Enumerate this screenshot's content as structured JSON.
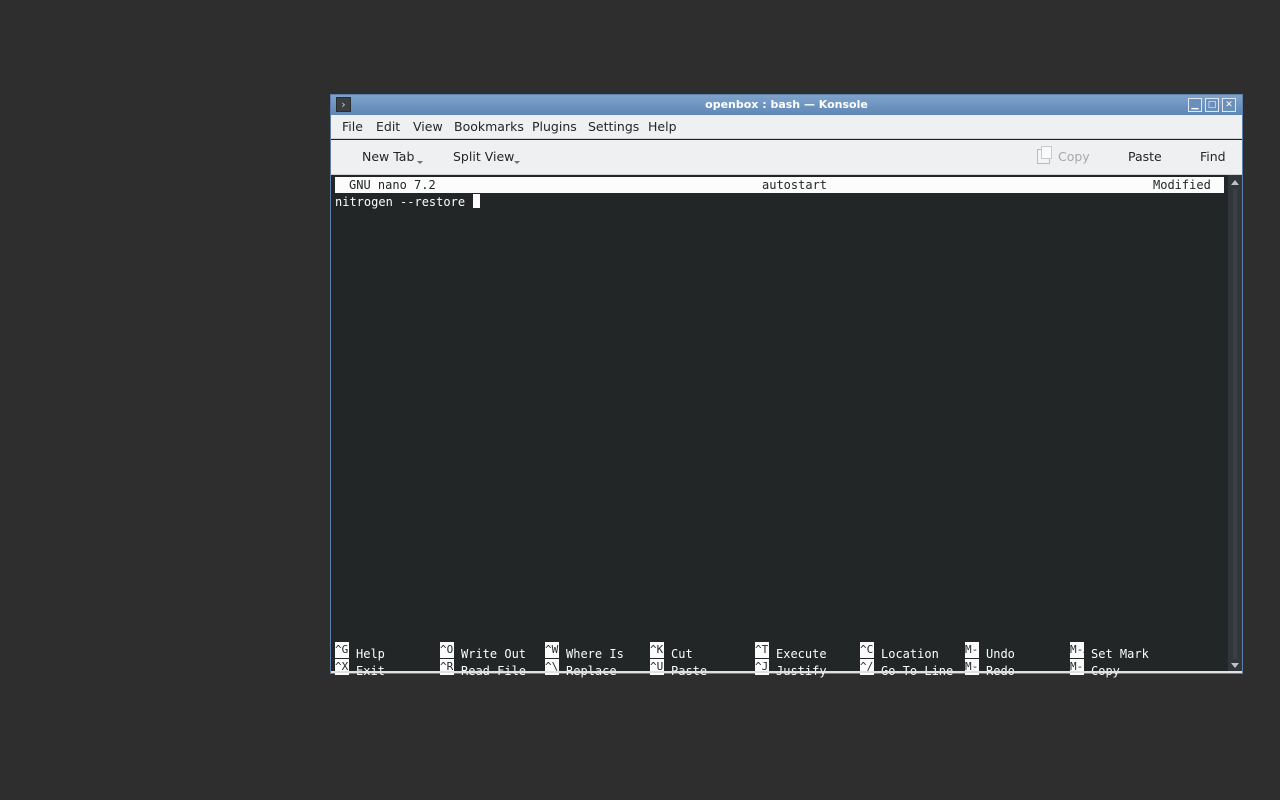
{
  "window": {
    "title": "openbox : bash — Konsole",
    "controls": {
      "minimize": "▁",
      "maximize": "□",
      "close": "✕"
    }
  },
  "menubar": {
    "items": [
      "File",
      "Edit",
      "View",
      "Bookmarks",
      "Plugins",
      "Settings",
      "Help"
    ]
  },
  "toolbar": {
    "new_tab": "New Tab",
    "split_view": "Split View",
    "copy": "Copy",
    "paste": "Paste",
    "find": "Find"
  },
  "nano": {
    "version": "GNU nano 7.2",
    "filename": "autostart",
    "status": "Modified",
    "lines": [
      "nitrogen --restore "
    ],
    "shortcuts_row1": [
      {
        "key": "^G",
        "label": "Help"
      },
      {
        "key": "^O",
        "label": "Write Out"
      },
      {
        "key": "^W",
        "label": "Where Is"
      },
      {
        "key": "^K",
        "label": "Cut"
      },
      {
        "key": "^T",
        "label": "Execute"
      },
      {
        "key": "^C",
        "label": "Location"
      },
      {
        "key": "M-U",
        "label": "Undo"
      },
      {
        "key": "M-A",
        "label": "Set Mark"
      }
    ],
    "shortcuts_row2": [
      {
        "key": "^X",
        "label": "Exit"
      },
      {
        "key": "^R",
        "label": "Read File"
      },
      {
        "key": "^\\",
        "label": "Replace"
      },
      {
        "key": "^U",
        "label": "Paste"
      },
      {
        "key": "^J",
        "label": "Justify"
      },
      {
        "key": "^/",
        "label": "Go To Line"
      },
      {
        "key": "M-E",
        "label": "Redo"
      },
      {
        "key": "M-6",
        "label": "Copy"
      }
    ]
  },
  "colors": {
    "titlebar": "#6f95c2",
    "terminal_bg": "#232627",
    "terminal_fg": "#fcfcfc",
    "desktop": "#2e2e2e"
  }
}
